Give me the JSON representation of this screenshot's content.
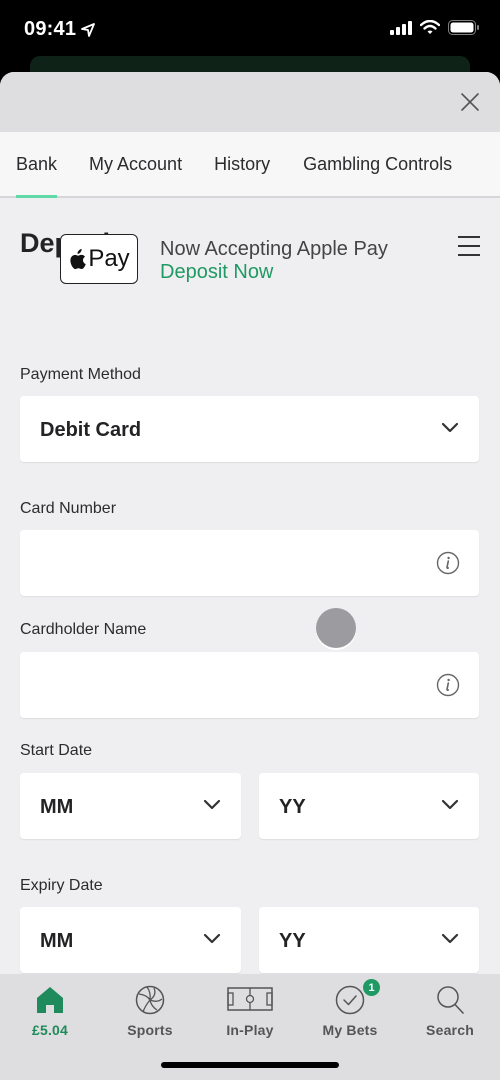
{
  "status_bar": {
    "time": "09:41",
    "icons": [
      "location-arrow-icon",
      "cellular-signal-icon",
      "wifi-icon",
      "battery-icon"
    ]
  },
  "header": {
    "close_icon": "close-icon"
  },
  "tabs": [
    {
      "label": "Bank",
      "active": true
    },
    {
      "label": "My Account",
      "active": false
    },
    {
      "label": "History",
      "active": false
    },
    {
      "label": "Gambling Controls",
      "active": false
    }
  ],
  "page": {
    "title": "Deposit",
    "menu_icon": "hamburger-menu-icon"
  },
  "apple_pay": {
    "badge_text": "Pay",
    "title": "Now Accepting Apple Pay",
    "link": "Deposit Now"
  },
  "form": {
    "payment_method": {
      "label": "Payment Method",
      "value": "Debit Card"
    },
    "card_number": {
      "label": "Card Number",
      "value": ""
    },
    "cardholder_name": {
      "label": "Cardholder Name",
      "value": ""
    },
    "start_date": {
      "label": "Start Date",
      "month": "MM",
      "year": "YY"
    },
    "expiry_date": {
      "label": "Expiry Date",
      "month": "MM",
      "year": "YY"
    }
  },
  "tabbar": [
    {
      "label": "£5.04",
      "icon": "home-icon",
      "active": true
    },
    {
      "label": "Sports",
      "icon": "volleyball-icon",
      "active": false
    },
    {
      "label": "In-Play",
      "icon": "pitch-icon",
      "active": false
    },
    {
      "label": "My Bets",
      "icon": "check-circle-icon",
      "active": false,
      "badge": "1"
    },
    {
      "label": "Search",
      "icon": "search-icon",
      "active": false
    }
  ],
  "colors": {
    "accent_green": "#1f9a64",
    "tab_underline": "#5fd9a8"
  }
}
